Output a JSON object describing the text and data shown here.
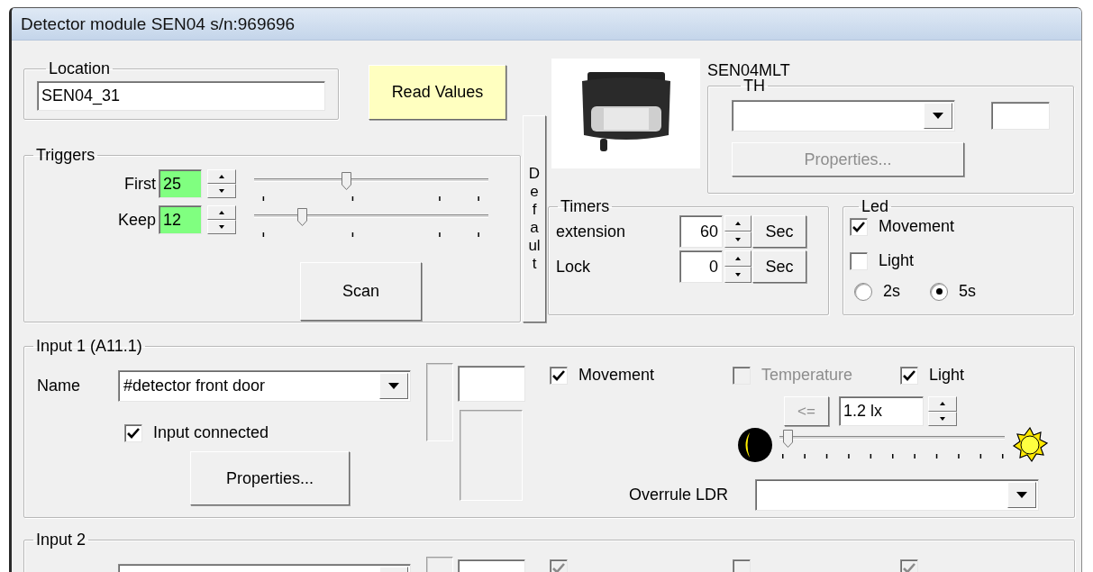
{
  "window": {
    "title": "Detector module SEN04 s/n:969696"
  },
  "location": {
    "label": "Location",
    "value": "SEN04_31"
  },
  "read_values_button": "Read Values",
  "default_button": "Default",
  "triggers": {
    "label": "Triggers",
    "rows": [
      {
        "label": "First",
        "value": "25",
        "level": 0.38
      },
      {
        "label": "Keep",
        "value": "12",
        "level": 0.18
      }
    ],
    "scan_button": "Scan"
  },
  "device": {
    "model": "SEN04MLT"
  },
  "th": {
    "label": "TH",
    "properties_button": {
      "label": "Properties...",
      "disabled": true
    }
  },
  "timers": {
    "label": "Timers",
    "rows": [
      {
        "label": "extension",
        "value": "60",
        "unit": "Sec"
      },
      {
        "label": "Lock",
        "value": "0",
        "unit": "Sec"
      }
    ]
  },
  "led": {
    "label": "Led",
    "checks": [
      {
        "label": "Movement",
        "checked": true
      },
      {
        "label": "Light",
        "checked": false
      }
    ],
    "radios": [
      {
        "label": "2s",
        "selected": false
      },
      {
        "label": "5s",
        "selected": true
      }
    ]
  },
  "inputs": [
    {
      "label": "Input 1 (A11.1)",
      "name_label": "Name",
      "name_value": "#detector front door",
      "connected": {
        "label": "Input connected",
        "checked": true
      },
      "properties_button": "Properties...",
      "sensors": [
        {
          "label": "Movement",
          "checked": true,
          "disabled": false
        },
        {
          "label": "Temperature",
          "checked": false,
          "disabled": true
        },
        {
          "label": "Light",
          "checked": true,
          "disabled": false
        }
      ],
      "compare_button": {
        "label": "<=",
        "disabled": true
      },
      "lux_value": "1.2 lx",
      "light_slider": {
        "level": 0
      },
      "overrule_label": "Overrule LDR"
    },
    {
      "label": "Input 2",
      "sensors": [
        {
          "checked": true,
          "disabled": true
        },
        {
          "checked": false,
          "disabled": true
        },
        {
          "checked": true,
          "disabled": true
        }
      ]
    }
  ]
}
